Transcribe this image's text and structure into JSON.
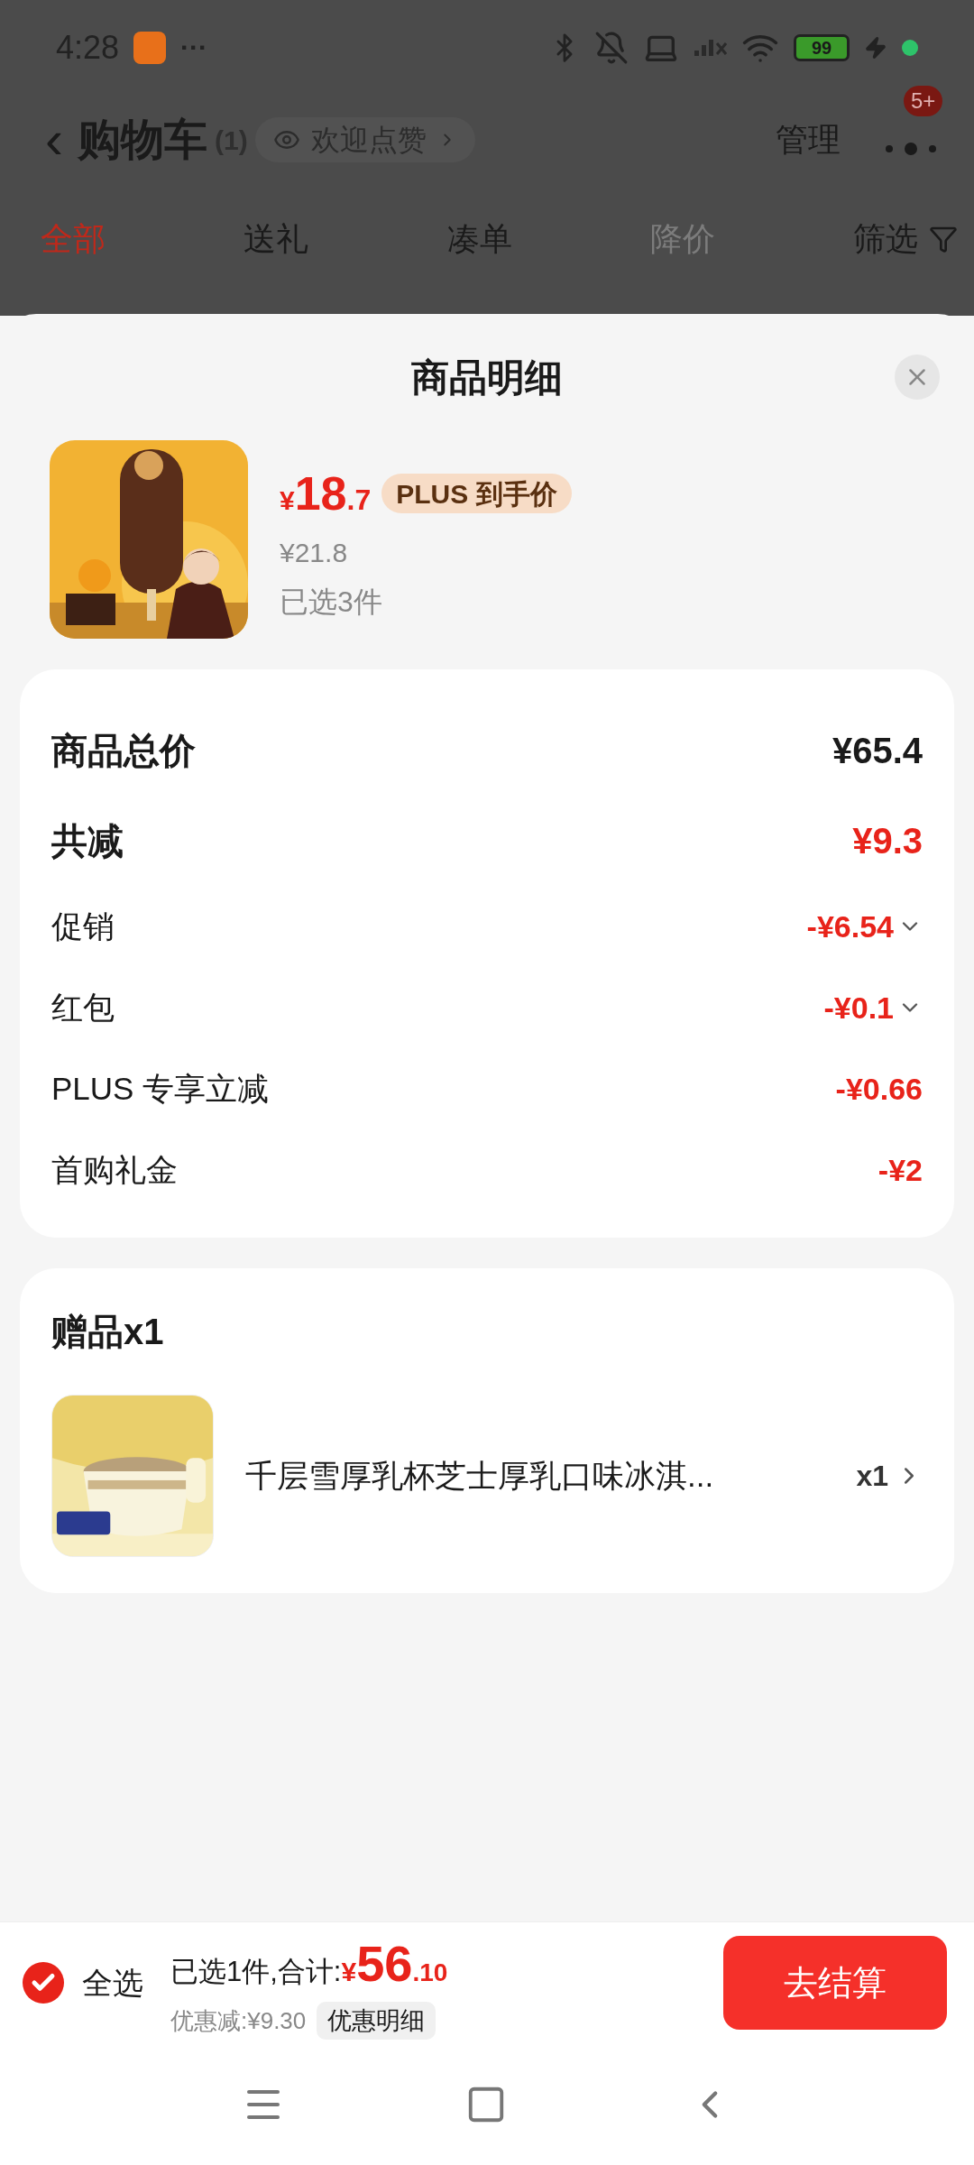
{
  "status_bar": {
    "time": "4:28",
    "more": "···",
    "battery": "99"
  },
  "header": {
    "back": "‹",
    "title": "购物车",
    "count": "(1)",
    "chip": "欢迎点赞",
    "manage": "管理",
    "badge": "5+"
  },
  "tabs": [
    {
      "label": "全部",
      "selected": true,
      "disabled": false
    },
    {
      "label": "送礼",
      "selected": false,
      "disabled": false
    },
    {
      "label": "凑单",
      "selected": false,
      "disabled": false
    },
    {
      "label": "降价",
      "selected": false,
      "disabled": true
    },
    {
      "label": "筛选",
      "selected": false,
      "disabled": false,
      "kind": "filter"
    }
  ],
  "sheet": {
    "title": "商品明细",
    "product": {
      "currency": "¥",
      "price_int": "18",
      "price_dec": ".7",
      "tag": "PLUS 到手价",
      "original_price": "¥21.8",
      "selected_count": "已选3件"
    },
    "summary": [
      {
        "label": "商品总价",
        "value": "¥65.4",
        "kind": "total"
      },
      {
        "label": "共减",
        "value": "¥9.3",
        "kind": "discount_total"
      },
      {
        "label": "促销",
        "value": "-¥6.54",
        "kind": "expandable"
      },
      {
        "label": "红包",
        "value": "-¥0.1",
        "kind": "expandable"
      },
      {
        "label": "PLUS 专享立减",
        "value": "-¥0.66",
        "kind": "plain"
      },
      {
        "label": "首购礼金",
        "value": "-¥2",
        "kind": "plain"
      }
    ],
    "gifts": {
      "title": "赠品x1",
      "items": [
        {
          "name": "千层雪厚乳杯芝士厚乳口味冰淇...",
          "qty": "x1"
        }
      ]
    }
  },
  "bottom_bar": {
    "select_all": {
      "label": "全选",
      "checked": true
    },
    "summary": "已选1件,合计:",
    "currency": "¥",
    "total_int": "56",
    "total_dec": ".10",
    "saving": "优惠减:¥9.30",
    "detail_button": "优惠明细",
    "checkout": "去结算"
  }
}
